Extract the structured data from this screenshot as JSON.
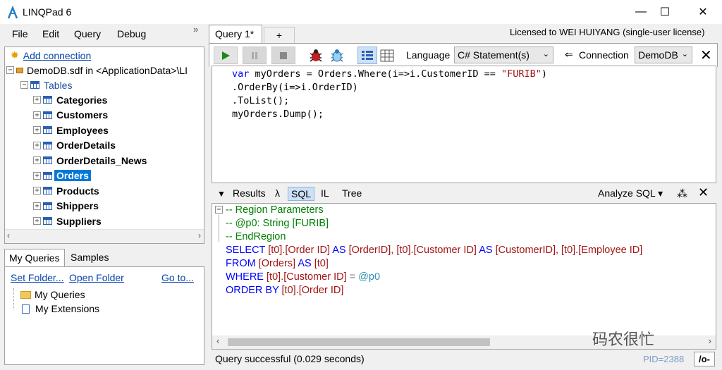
{
  "window": {
    "title": "LINQPad 6",
    "minimize": "—",
    "maximize": "☐",
    "close": "✕"
  },
  "menu": {
    "file": "File",
    "edit": "Edit",
    "query": "Query",
    "debug": "Debug",
    "collapse": "»"
  },
  "tree": {
    "add_connection": "Add connection",
    "connection": "DemoDB.sdf in <ApplicationData>\\LI",
    "tables": "Tables",
    "items": [
      "Categories",
      "Customers",
      "Employees",
      "OrderDetails",
      "OrderDetails_News",
      "Orders",
      "Products",
      "Shippers",
      "Suppliers"
    ],
    "selected": "Orders"
  },
  "bottom_left": {
    "tabs": [
      "My Queries",
      "Samples"
    ],
    "set_folder": "Set Folder...",
    "open_folder": "Open Folder",
    "go_to": "Go to...",
    "items": [
      "My Queries",
      "My Extensions"
    ]
  },
  "query_tabs": {
    "active": "Query 1*",
    "add": "+"
  },
  "license": "Licensed to WEI HUIYANG (single-user license)",
  "toolbar": {
    "language_label": "Language",
    "language_value": "C# Statement(s)",
    "connection_label": "Connection",
    "connection_value": "DemoDB",
    "close": "✕"
  },
  "code": {
    "line1_kw": "var",
    "line1_a": " myOrders = Orders.Where(i=>i.CustomerID == ",
    "line1_str": "\"FURIB\"",
    "line1_b": ")",
    "line2": ".OrderBy(i=>i.OrderID)",
    "line3": ".ToList();",
    "line4": "myOrders.Dump();"
  },
  "results_tabs": {
    "results": "Results",
    "lambda": "λ",
    "sql": "SQL",
    "il": "IL",
    "tree": "Tree",
    "analyze": "Analyze SQL ▾",
    "close": "✕"
  },
  "sql": {
    "region": "-- Region Parameters",
    "param": "-- @p0: String [FURIB]",
    "endregion": "-- EndRegion",
    "select_kw": "SELECT",
    "select_a": "[t0].[Order ID]",
    "as1": "AS",
    "select_b": "[OrderID],",
    "select_c": "[t0].[Customer ID]",
    "as2": "AS",
    "select_d": "[CustomerID],",
    "select_e": "[t0].[Employee ID]",
    "from_kw": "FROM",
    "from_a": "[Orders]",
    "as3": "AS",
    "from_b": "[t0]",
    "where_kw": "WHERE",
    "where_a": "[t0].[Customer ID]",
    "where_eq": "=",
    "where_param": "@p0",
    "order_kw": "ORDER BY",
    "order_a": "[t0].[Order ID]"
  },
  "status": {
    "message": "Query successful  (0.029 seconds)",
    "pid": "PID=2388",
    "toggle": "/o-"
  },
  "watermark": "码农很忙",
  "colors": {
    "selection": "#0078d7",
    "link": "#0645ad",
    "keyword": "#0000ff",
    "string": "#a31515",
    "comment": "#008000"
  }
}
